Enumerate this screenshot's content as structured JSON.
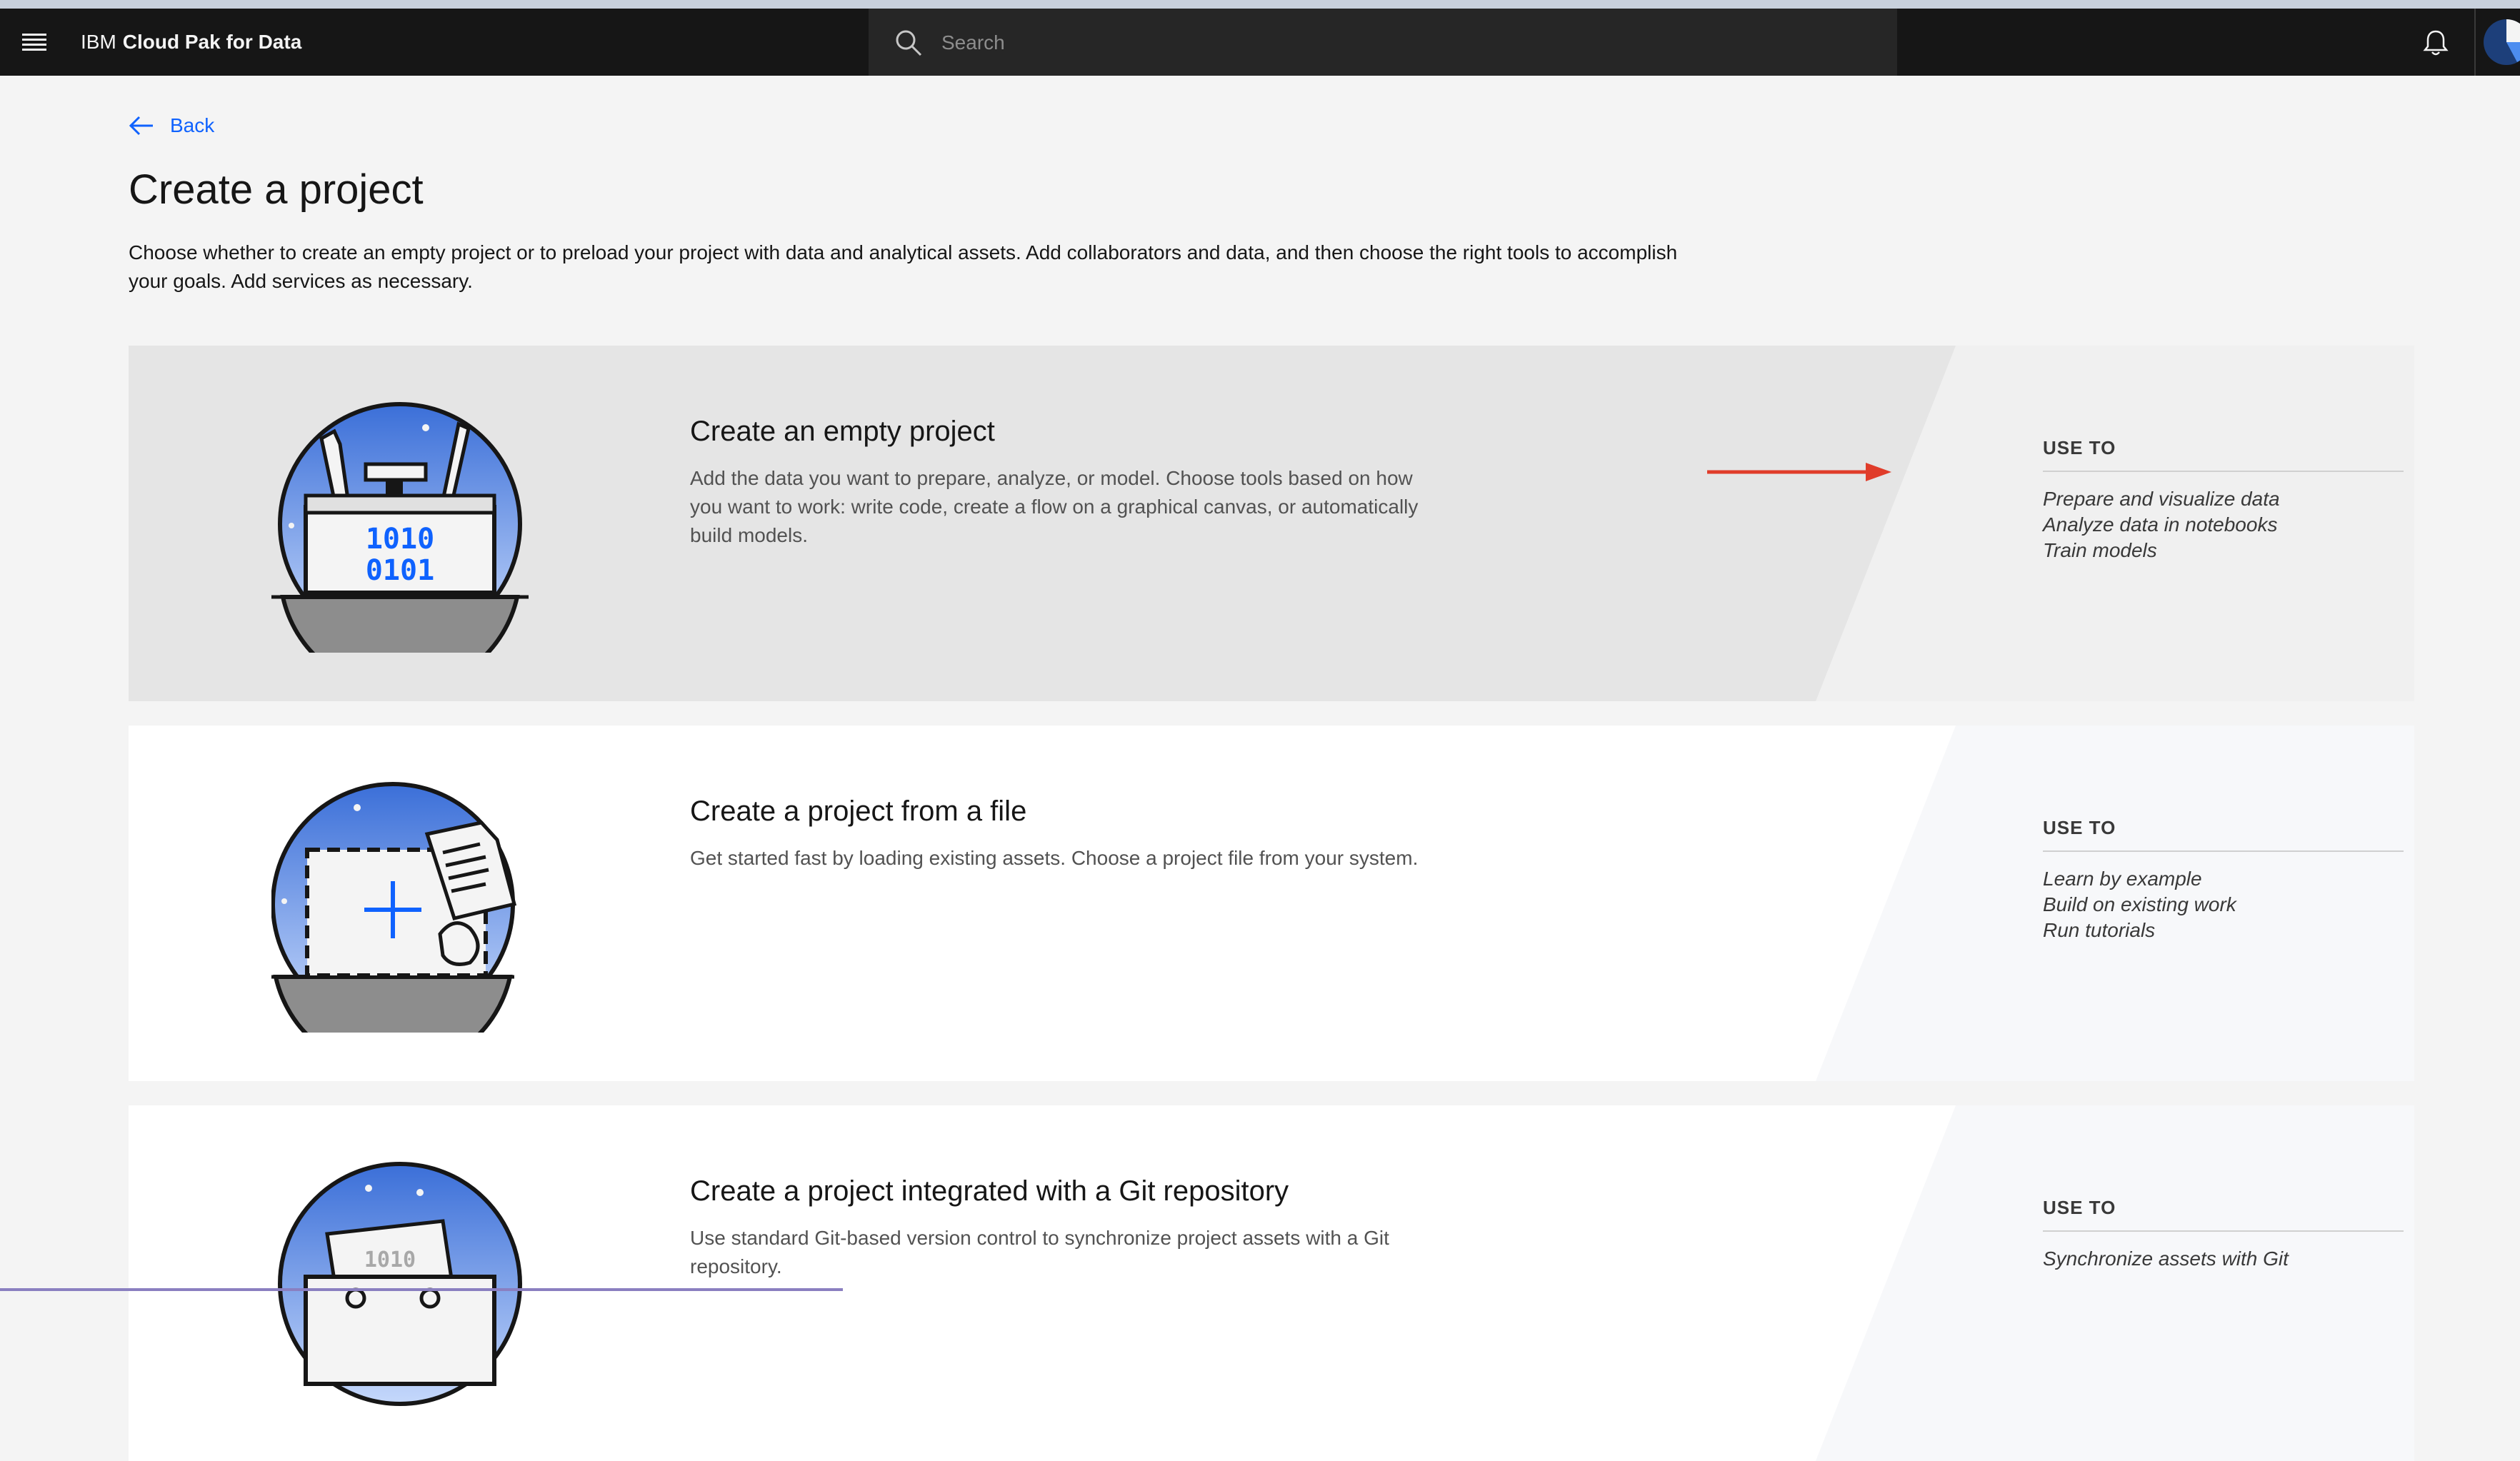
{
  "header": {
    "brand_prefix": "IBM",
    "product_name": "Cloud Pak for Data",
    "search_placeholder": "Search"
  },
  "nav": {
    "back_label": "Back"
  },
  "page": {
    "title": "Create a project",
    "description": "Choose whether to create an empty project or to preload your project with data and analytical assets. Add collaborators and data, and then choose the right tools to accomplish your goals. Add services as necessary."
  },
  "cards": [
    {
      "title": "Create an empty project",
      "description": "Add the data you want to prepare, analyze, or model. Choose tools based on how you want to work: write code, create a flow on a graphical canvas, or automatically build models.",
      "use_to_label": "USE TO",
      "use_to": [
        "Prepare and visualize data",
        "Analyze data in notebooks",
        "Train models"
      ],
      "illustration_text": [
        "1010",
        "0101"
      ]
    },
    {
      "title": "Create a project from a file",
      "description": "Get started fast by loading existing assets. Choose a project file from your system.",
      "use_to_label": "USE TO",
      "use_to": [
        "Learn by example",
        "Build on existing work",
        "Run tutorials"
      ]
    },
    {
      "title": "Create a project integrated with a Git repository",
      "description": "Use standard Git-based version control to synchronize project assets with a Git repository.",
      "use_to_label": "USE TO",
      "use_to": [
        "Synchronize assets with Git"
      ],
      "illustration_text": [
        "1010"
      ]
    }
  ],
  "colors": {
    "header_bg": "#161616",
    "search_bg": "#262626",
    "link": "#0f62fe",
    "selected_card_bg": "#e5e5e5",
    "card_bg": "#ffffff",
    "annotation_arrow": "#e03c2a"
  },
  "icons": [
    "hamburger-menu-icon",
    "search-icon",
    "notification-bell-icon",
    "user-avatar-icon",
    "arrow-left-icon",
    "annotation-arrow-icon"
  ]
}
